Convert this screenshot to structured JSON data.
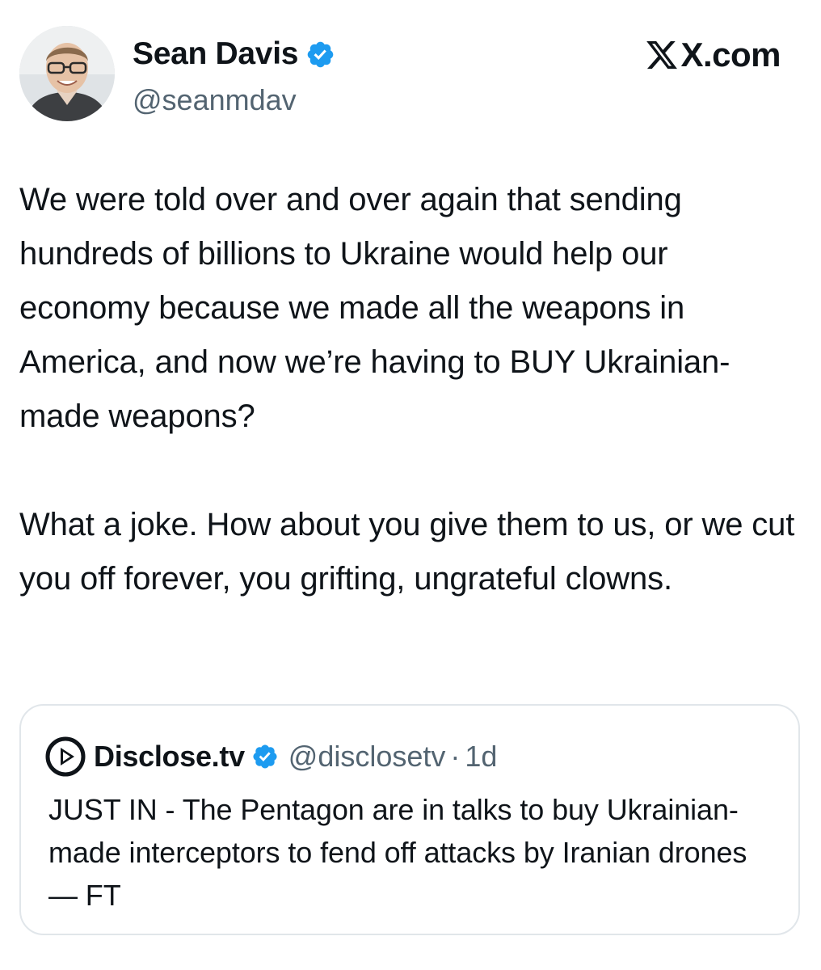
{
  "author": {
    "display_name": "Sean Davis",
    "handle": "@seanmdav",
    "verified_icon": "verified-badge-icon",
    "avatar_icon": "avatar-photo"
  },
  "brand": {
    "label": "X.com",
    "icon": "x-logo-icon"
  },
  "tweet": {
    "paragraphs": [
      "We were told over and over again that sending hundreds of billions to Ukraine would help our economy because we made all the weapons in America, and now we’re having to BUY Ukrainian-made weapons?",
      "What a joke. How about you give them to us, or we cut you off forever, you grifting, ungrateful clowns."
    ]
  },
  "quote": {
    "display_name": "Disclose.tv",
    "handle": "@disclosetv",
    "separator": "·",
    "time": "1d",
    "text": "JUST IN - The Pentagon are in talks to buy Ukrainian-made interceptors to fend off attacks by Iranian drones — FT",
    "logo_icon": "disclose-tv-logo-icon"
  },
  "colors": {
    "text": "#0f1419",
    "secondary": "#536471",
    "verified": "#1d9bf0",
    "border": "#e1e6ea"
  }
}
